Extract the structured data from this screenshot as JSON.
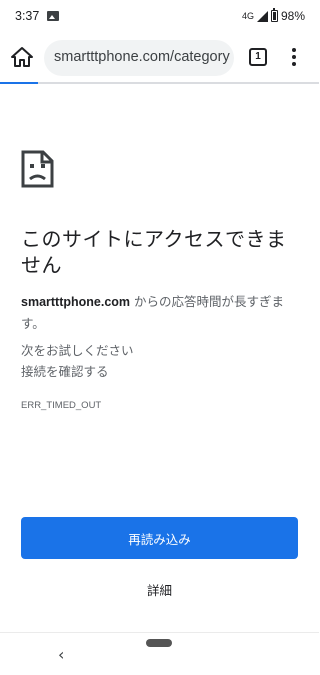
{
  "status_bar": {
    "time": "3:37",
    "network": "4G",
    "battery": "98%"
  },
  "toolbar": {
    "url": "smartttphone.com/category",
    "tab_count": "1"
  },
  "error_page": {
    "title": "このサイトにアクセスできません",
    "host": "smartttphone.com",
    "message_suffix": " からの応答時間が長すぎます。",
    "suggest_heading": "次をお試しください",
    "suggest_connection": "接続を確認する",
    "error_code": "ERR_TIMED_OUT",
    "reload_label": "再読み込み",
    "details_label": "詳細"
  },
  "nav_bar": {
    "back_glyph": "‹"
  },
  "colors": {
    "accent": "#1a73e8",
    "text_primary": "#202124",
    "text_secondary": "#5f6368"
  },
  "icons": [
    "photo-icon",
    "signal-icon",
    "battery-icon",
    "home-icon",
    "tabs-icon",
    "more-vert-icon",
    "sad-page-icon"
  ]
}
